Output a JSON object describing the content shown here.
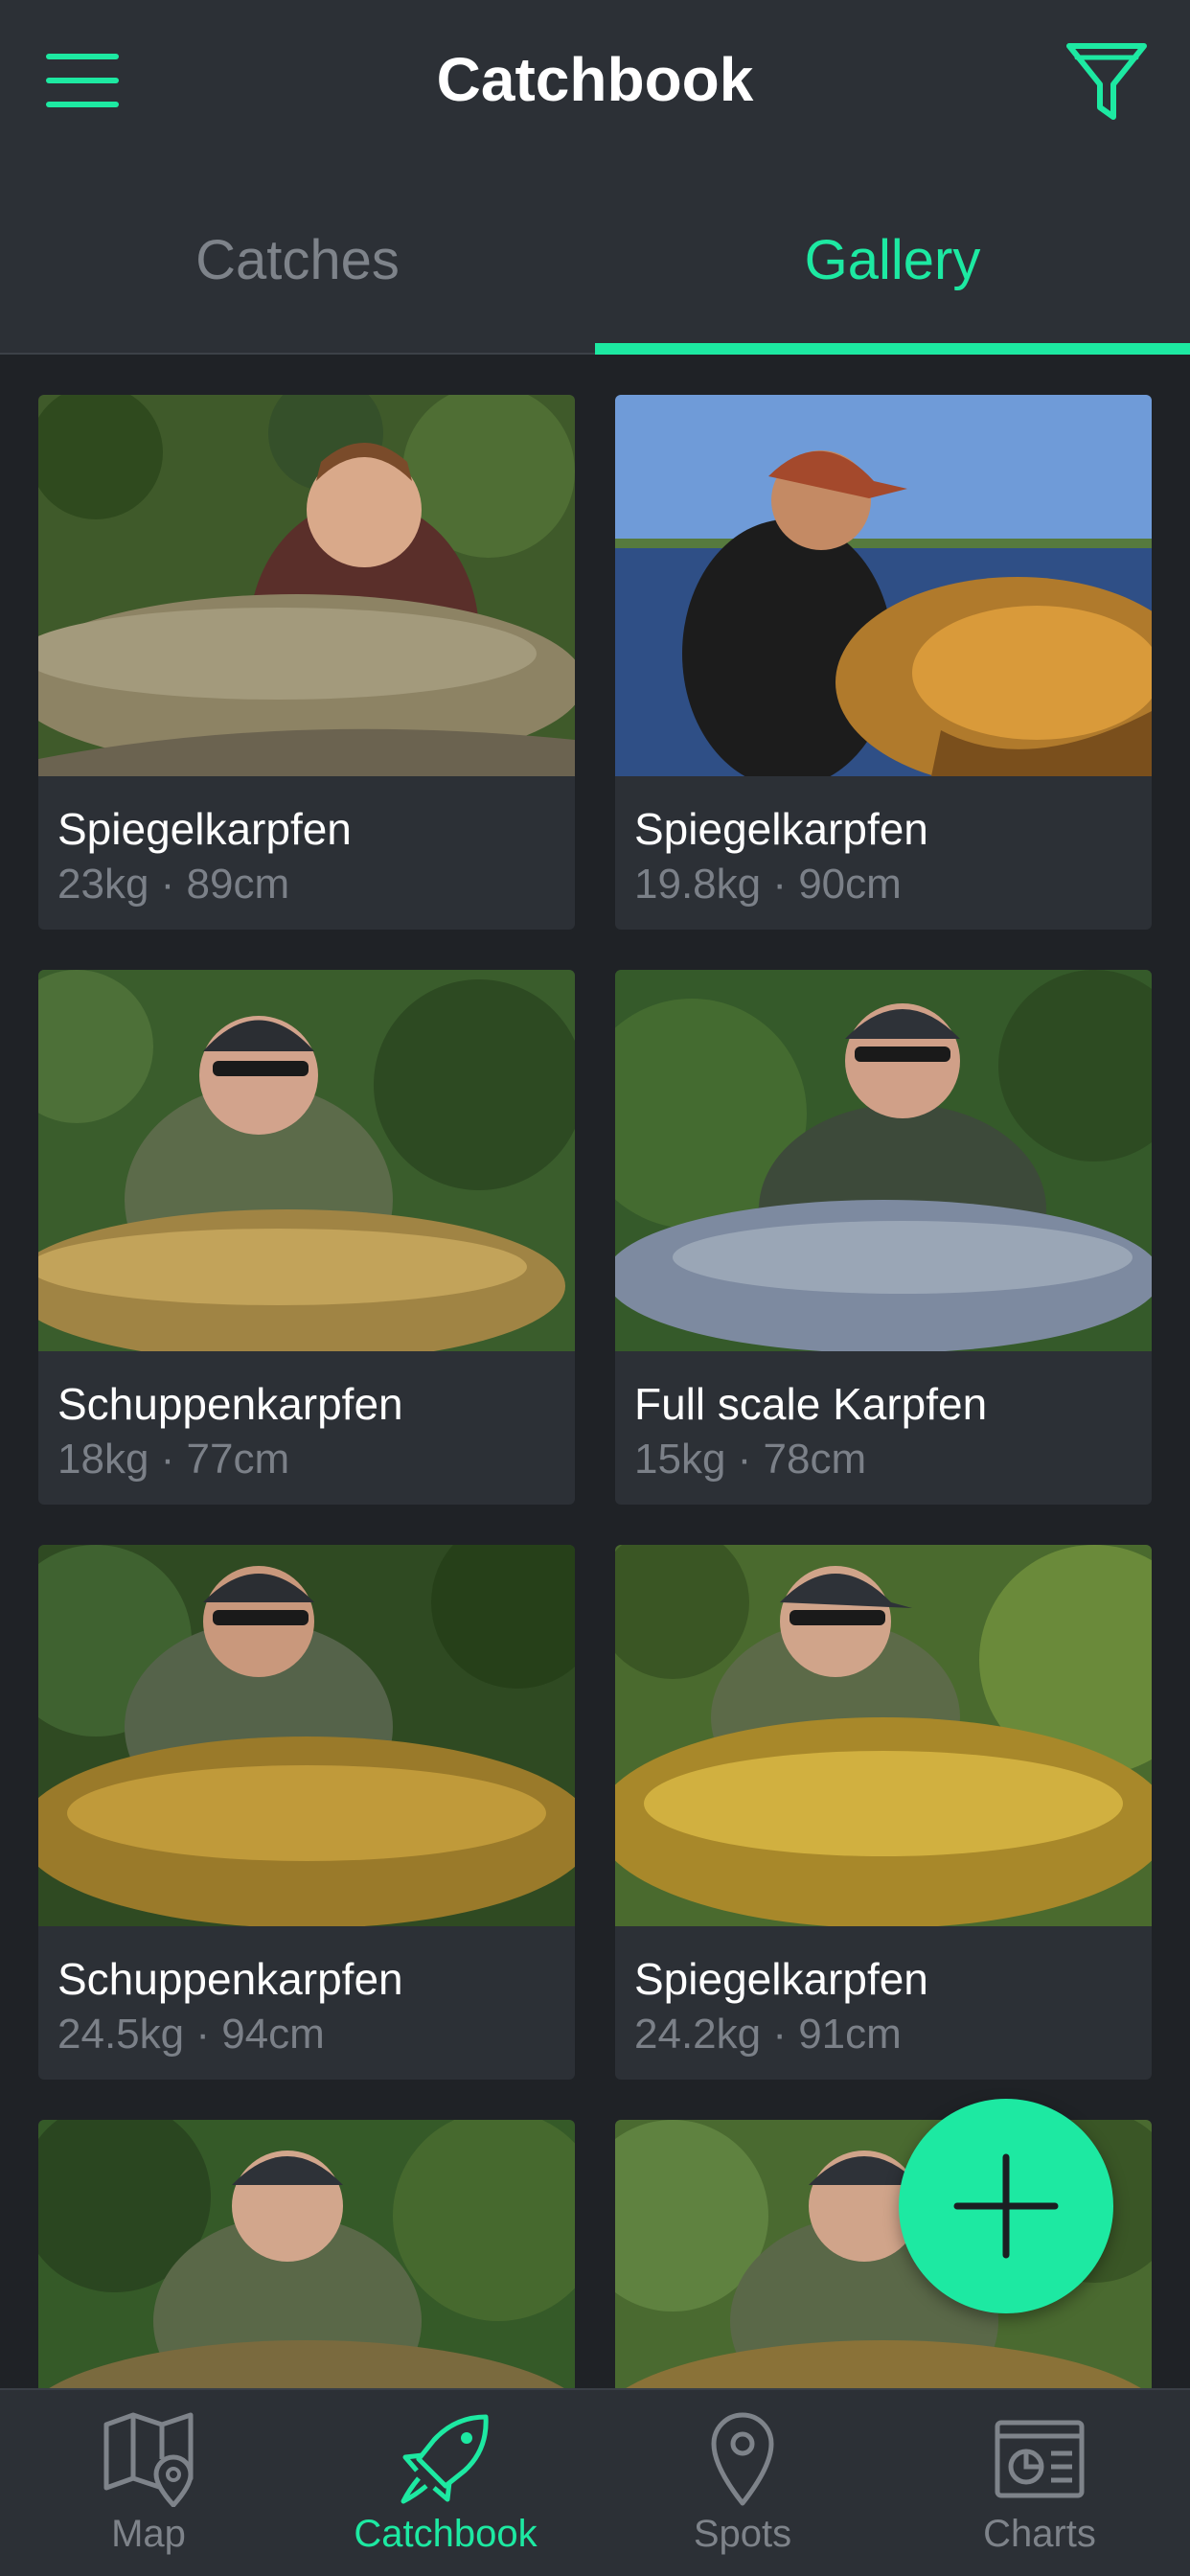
{
  "header": {
    "title": "Catchbook",
    "menu_icon": "hamburger-menu-icon",
    "filter_icon": "filter-funnel-icon",
    "accent_color": "#1de9a2"
  },
  "tabs": [
    {
      "label": "Catches",
      "active": false
    },
    {
      "label": "Gallery",
      "active": true
    }
  ],
  "gallery": [
    {
      "species": "Spiegelkarpfen",
      "stats": "23kg · 89cm"
    },
    {
      "species": "Spiegelkarpfen",
      "stats": "19.8kg · 90cm"
    },
    {
      "species": "Schuppenkarpfen",
      "stats": "18kg · 77cm"
    },
    {
      "species": "Full scale Karpfen",
      "stats": "15kg · 78cm"
    },
    {
      "species": "Schuppenkarpfen",
      "stats": "24.5kg · 94cm"
    },
    {
      "species": "Spiegelkarpfen",
      "stats": "24.2kg · 91cm"
    },
    {
      "species": "",
      "stats": ""
    },
    {
      "species": "",
      "stats": ""
    }
  ],
  "fab": {
    "icon": "plus-icon"
  },
  "bottom_nav": [
    {
      "label": "Map",
      "icon": "map-pin-icon",
      "active": false
    },
    {
      "label": "Catchbook",
      "icon": "fish-icon",
      "active": true
    },
    {
      "label": "Spots",
      "icon": "location-pin-icon",
      "active": false
    },
    {
      "label": "Charts",
      "icon": "chart-dashboard-icon",
      "active": false
    }
  ]
}
